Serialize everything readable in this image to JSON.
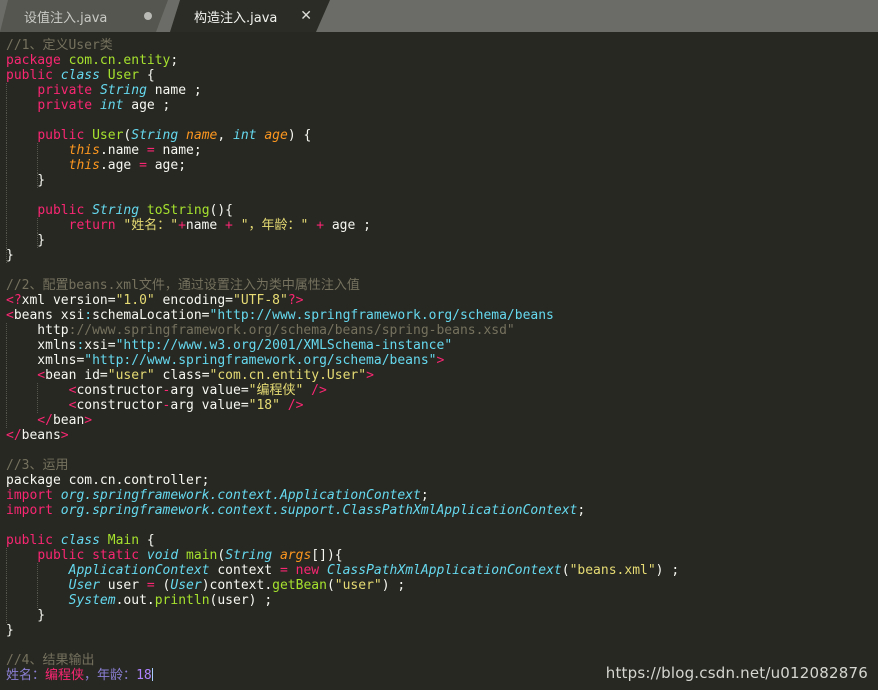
{
  "tabs": [
    {
      "label": "设值注入.java",
      "state": "inactive",
      "indicator": "modified-dot"
    },
    {
      "label": "构造注入.java",
      "state": "active",
      "indicator": "close-x",
      "close_label": "✕"
    }
  ],
  "watermark": "https://blog.csdn.net/u012082876",
  "code_lines": [
    [
      {
        "t": "//1、定义User类",
        "c": "c"
      }
    ],
    [
      {
        "t": "package",
        "c": "k"
      },
      {
        "t": " ",
        "c": "p"
      },
      {
        "t": "com.cn.entity",
        "c": "f"
      },
      {
        "t": ";",
        "c": "p"
      }
    ],
    [
      {
        "t": "public",
        "c": "k"
      },
      {
        "t": " ",
        "c": "p"
      },
      {
        "t": "class",
        "c": "t"
      },
      {
        "t": " ",
        "c": "p"
      },
      {
        "t": "User",
        "c": "f"
      },
      {
        "t": " {",
        "c": "p"
      }
    ],
    [
      {
        "t": "    ",
        "c": "p"
      },
      {
        "t": "private",
        "c": "k"
      },
      {
        "t": " ",
        "c": "p"
      },
      {
        "t": "String",
        "c": "t"
      },
      {
        "t": " name ;",
        "c": "p"
      }
    ],
    [
      {
        "t": "    ",
        "c": "p"
      },
      {
        "t": "private",
        "c": "k"
      },
      {
        "t": " ",
        "c": "p"
      },
      {
        "t": "int",
        "c": "t"
      },
      {
        "t": " age ;",
        "c": "p"
      }
    ],
    [],
    [
      {
        "t": "    ",
        "c": "p"
      },
      {
        "t": "public",
        "c": "k"
      },
      {
        "t": " ",
        "c": "p"
      },
      {
        "t": "User",
        "c": "f"
      },
      {
        "t": "(",
        "c": "p"
      },
      {
        "t": "String",
        "c": "t"
      },
      {
        "t": " ",
        "c": "p"
      },
      {
        "t": "name",
        "c": "o"
      },
      {
        "t": ", ",
        "c": "p"
      },
      {
        "t": "int",
        "c": "t"
      },
      {
        "t": " ",
        "c": "p"
      },
      {
        "t": "age",
        "c": "o"
      },
      {
        "t": ") {",
        "c": "p"
      }
    ],
    [
      {
        "t": "        ",
        "c": "p"
      },
      {
        "t": "this",
        "c": "o"
      },
      {
        "t": ".name ",
        "c": "p"
      },
      {
        "t": "=",
        "c": "k"
      },
      {
        "t": " name;",
        "c": "p"
      }
    ],
    [
      {
        "t": "        ",
        "c": "p"
      },
      {
        "t": "this",
        "c": "o"
      },
      {
        "t": ".age ",
        "c": "p"
      },
      {
        "t": "=",
        "c": "k"
      },
      {
        "t": " age;",
        "c": "p"
      }
    ],
    [
      {
        "t": "    }",
        "c": "p"
      }
    ],
    [],
    [
      {
        "t": "    ",
        "c": "p"
      },
      {
        "t": "public",
        "c": "k"
      },
      {
        "t": " ",
        "c": "p"
      },
      {
        "t": "String",
        "c": "t"
      },
      {
        "t": " ",
        "c": "p"
      },
      {
        "t": "toString",
        "c": "f"
      },
      {
        "t": "(){",
        "c": "p"
      }
    ],
    [
      {
        "t": "        ",
        "c": "p"
      },
      {
        "t": "return",
        "c": "k"
      },
      {
        "t": " ",
        "c": "p"
      },
      {
        "t": "\"姓名：\"",
        "c": "s"
      },
      {
        "t": "+",
        "c": "k"
      },
      {
        "t": "name ",
        "c": "p"
      },
      {
        "t": "+",
        "c": "k"
      },
      {
        "t": " ",
        "c": "p"
      },
      {
        "t": "\"，年龄：\"",
        "c": "s"
      },
      {
        "t": " ",
        "c": "p"
      },
      {
        "t": "+",
        "c": "k"
      },
      {
        "t": " age ;",
        "c": "p"
      }
    ],
    [
      {
        "t": "    }",
        "c": "p"
      }
    ],
    [
      {
        "t": "}",
        "c": "p"
      }
    ],
    [],
    [
      {
        "t": "//2、配置beans.xml文件，通过设置注入为类中属性注入值",
        "c": "c"
      }
    ],
    [
      {
        "t": "<?",
        "c": "tag"
      },
      {
        "t": "xml",
        "c": "tagname"
      },
      {
        "t": " version=",
        "c": "p"
      },
      {
        "t": "\"1.0\"",
        "c": "s"
      },
      {
        "t": " encoding=",
        "c": "p"
      },
      {
        "t": "\"UTF-8\"",
        "c": "s"
      },
      {
        "t": "?>",
        "c": "tag"
      }
    ],
    [
      {
        "t": "<",
        "c": "tag"
      },
      {
        "t": "beans",
        "c": "tagname"
      },
      {
        "t": " xsi",
        "c": "p"
      },
      {
        "t": ":",
        "c": "tn"
      },
      {
        "t": "schemaLocation=",
        "c": "p"
      },
      {
        "t": "\"http://www.springframework.org/schema/beans",
        "c": "tn"
      }
    ],
    [
      {
        "t": "    http",
        "c": "p"
      },
      {
        "t": "://www.springframework.org/schema/beans/spring-beans.xsd\"",
        "c": "d"
      }
    ],
    [
      {
        "t": "    xmlns",
        "c": "p"
      },
      {
        "t": ":",
        "c": "tn"
      },
      {
        "t": "xsi=",
        "c": "p"
      },
      {
        "t": "\"http://www.w3.org/2001/XMLSchema-instance\"",
        "c": "tn"
      }
    ],
    [
      {
        "t": "    xmlns=",
        "c": "p"
      },
      {
        "t": "\"http://www.springframework.org/schema/beans\"",
        "c": "tn"
      },
      {
        "t": ">",
        "c": "tag"
      }
    ],
    [
      {
        "t": "    <",
        "c": "tag"
      },
      {
        "t": "bean",
        "c": "tagname"
      },
      {
        "t": " id=",
        "c": "p"
      },
      {
        "t": "\"user\"",
        "c": "s"
      },
      {
        "t": " class=",
        "c": "p"
      },
      {
        "t": "\"com.cn.entity.User\"",
        "c": "s"
      },
      {
        "t": ">",
        "c": "tag"
      }
    ],
    [
      {
        "t": "        <",
        "c": "tag"
      },
      {
        "t": "constructor",
        "c": "tagname"
      },
      {
        "t": "-",
        "c": "tag"
      },
      {
        "t": "arg",
        "c": "tagname"
      },
      {
        "t": " value=",
        "c": "p"
      },
      {
        "t": "\"编程侠\"",
        "c": "s"
      },
      {
        "t": " ",
        "c": "p"
      },
      {
        "t": "/>",
        "c": "tag"
      }
    ],
    [
      {
        "t": "        <",
        "c": "tag"
      },
      {
        "t": "constructor",
        "c": "tagname"
      },
      {
        "t": "-",
        "c": "tag"
      },
      {
        "t": "arg",
        "c": "tagname"
      },
      {
        "t": " value=",
        "c": "p"
      },
      {
        "t": "\"18\"",
        "c": "s"
      },
      {
        "t": " ",
        "c": "p"
      },
      {
        "t": "/>",
        "c": "tag"
      }
    ],
    [
      {
        "t": "    <",
        "c": "tag"
      },
      {
        "t": "/",
        "c": "tag"
      },
      {
        "t": "bean",
        "c": "tagname"
      },
      {
        "t": ">",
        "c": "tag"
      }
    ],
    [
      {
        "t": "<",
        "c": "tag"
      },
      {
        "t": "/",
        "c": "tag"
      },
      {
        "t": "beans",
        "c": "tagname"
      },
      {
        "t": ">",
        "c": "tag"
      }
    ],
    [],
    [
      {
        "t": "//3、运用",
        "c": "c"
      }
    ],
    [
      {
        "t": "package com.cn.controller;",
        "c": "p"
      }
    ],
    [
      {
        "t": "import",
        "c": "k"
      },
      {
        "t": " ",
        "c": "p"
      },
      {
        "t": "org.springframework.context.ApplicationContext",
        "c": "t"
      },
      {
        "t": ";",
        "c": "p"
      }
    ],
    [
      {
        "t": "import",
        "c": "k"
      },
      {
        "t": " ",
        "c": "p"
      },
      {
        "t": "org.springframework.context.support.ClassPathXmlApplicationContext",
        "c": "t"
      },
      {
        "t": ";",
        "c": "p"
      }
    ],
    [],
    [
      {
        "t": "public",
        "c": "k"
      },
      {
        "t": " ",
        "c": "p"
      },
      {
        "t": "class",
        "c": "t"
      },
      {
        "t": " ",
        "c": "p"
      },
      {
        "t": "Main",
        "c": "f"
      },
      {
        "t": " {",
        "c": "p"
      }
    ],
    [
      {
        "t": "    ",
        "c": "p"
      },
      {
        "t": "public",
        "c": "k"
      },
      {
        "t": " ",
        "c": "p"
      },
      {
        "t": "static",
        "c": "k"
      },
      {
        "t": " ",
        "c": "p"
      },
      {
        "t": "void",
        "c": "t"
      },
      {
        "t": " ",
        "c": "p"
      },
      {
        "t": "main",
        "c": "f"
      },
      {
        "t": "(",
        "c": "p"
      },
      {
        "t": "String",
        "c": "t"
      },
      {
        "t": " ",
        "c": "p"
      },
      {
        "t": "args",
        "c": "o"
      },
      {
        "t": "[]",
        "c": "p"
      },
      {
        "t": "){",
        "c": "p"
      }
    ],
    [
      {
        "t": "        ",
        "c": "p"
      },
      {
        "t": "ApplicationContext",
        "c": "t"
      },
      {
        "t": " context ",
        "c": "p"
      },
      {
        "t": "=",
        "c": "k"
      },
      {
        "t": " ",
        "c": "p"
      },
      {
        "t": "new",
        "c": "k"
      },
      {
        "t": " ",
        "c": "p"
      },
      {
        "t": "ClassPathXmlApplicationContext",
        "c": "t"
      },
      {
        "t": "(",
        "c": "p"
      },
      {
        "t": "\"beans.xml\"",
        "c": "s"
      },
      {
        "t": ") ;",
        "c": "p"
      }
    ],
    [
      {
        "t": "        ",
        "c": "p"
      },
      {
        "t": "User",
        "c": "t"
      },
      {
        "t": " user ",
        "c": "p"
      },
      {
        "t": "=",
        "c": "k"
      },
      {
        "t": " (",
        "c": "p"
      },
      {
        "t": "User",
        "c": "t"
      },
      {
        "t": ")context.",
        "c": "p"
      },
      {
        "t": "getBean",
        "c": "f"
      },
      {
        "t": "(",
        "c": "p"
      },
      {
        "t": "\"user\"",
        "c": "s"
      },
      {
        "t": ") ;",
        "c": "p"
      }
    ],
    [
      {
        "t": "        ",
        "c": "p"
      },
      {
        "t": "System",
        "c": "t"
      },
      {
        "t": ".out.",
        "c": "p"
      },
      {
        "t": "println",
        "c": "f"
      },
      {
        "t": "(user) ;",
        "c": "p"
      }
    ],
    [
      {
        "t": "    }",
        "c": "p"
      }
    ],
    [
      {
        "t": "}",
        "c": "p"
      }
    ],
    [],
    [
      {
        "t": "//4、结果输出",
        "c": "c"
      }
    ],
    [
      {
        "t": "姓名：",
        "c": "purple"
      },
      {
        "t": "编程侠",
        "c": "redtxt"
      },
      {
        "t": "，",
        "c": "purple"
      },
      {
        "t": "年龄：",
        "c": "purple"
      },
      {
        "t": "18",
        "c": "n"
      },
      {
        "t": "",
        "c": "cursor"
      }
    ]
  ],
  "indent_guides": [
    {
      "line": 3,
      "cols": [
        0
      ]
    },
    {
      "line": 4,
      "cols": [
        0
      ]
    },
    {
      "line": 5,
      "cols": [
        0
      ]
    },
    {
      "line": 6,
      "cols": [
        0
      ]
    },
    {
      "line": 7,
      "cols": [
        0,
        4
      ]
    },
    {
      "line": 8,
      "cols": [
        0,
        4
      ]
    },
    {
      "line": 9,
      "cols": [
        0,
        4
      ]
    },
    {
      "line": 10,
      "cols": [
        0
      ]
    },
    {
      "line": 11,
      "cols": [
        0
      ]
    },
    {
      "line": 12,
      "cols": [
        0,
        4
      ]
    },
    {
      "line": 13,
      "cols": [
        0,
        4
      ]
    },
    {
      "line": 14,
      "cols": [
        0
      ]
    },
    {
      "line": 19,
      "cols": [
        0
      ]
    },
    {
      "line": 20,
      "cols": [
        0
      ]
    },
    {
      "line": 21,
      "cols": [
        0
      ]
    },
    {
      "line": 22,
      "cols": [
        0
      ]
    },
    {
      "line": 23,
      "cols": [
        0,
        4
      ]
    },
    {
      "line": 24,
      "cols": [
        0,
        4
      ]
    },
    {
      "line": 25,
      "cols": [
        0
      ]
    },
    {
      "line": 34,
      "cols": [
        0
      ]
    },
    {
      "line": 35,
      "cols": [
        0,
        4
      ]
    },
    {
      "line": 36,
      "cols": [
        0,
        4
      ]
    },
    {
      "line": 37,
      "cols": [
        0,
        4
      ]
    },
    {
      "line": 38,
      "cols": [
        0
      ]
    }
  ]
}
